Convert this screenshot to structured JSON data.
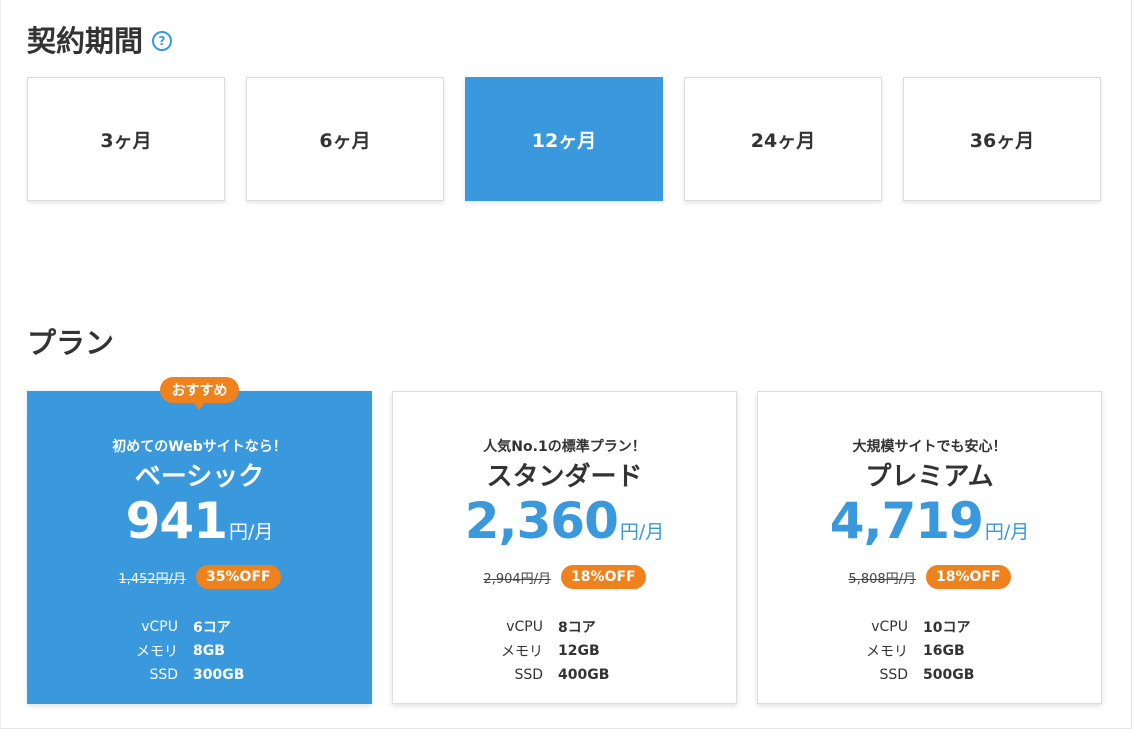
{
  "contract": {
    "title": "契約期間",
    "help_icon": "?",
    "terms": [
      {
        "label": "3ヶ月",
        "selected": false
      },
      {
        "label": "6ヶ月",
        "selected": false
      },
      {
        "label": "12ヶ月",
        "selected": true
      },
      {
        "label": "24ヶ月",
        "selected": false
      },
      {
        "label": "36ヶ月",
        "selected": false
      }
    ]
  },
  "plans": {
    "title": "プラン",
    "recommended_badge": "おすすめ",
    "items": [
      {
        "tagline": "初めてのWebサイトなら！",
        "name": "ベーシック",
        "price": "941",
        "unit": "円/月",
        "old_price": "1,452円/月",
        "discount": "35%OFF",
        "featured": true,
        "specs": [
          {
            "label": "vCPU",
            "value": "6コア"
          },
          {
            "label": "メモリ",
            "value": "8GB"
          },
          {
            "label": "SSD",
            "value": "300GB"
          }
        ]
      },
      {
        "tagline": "人気No.1の標準プラン！",
        "name": "スタンダード",
        "price": "2,360",
        "unit": "円/月",
        "old_price": "2,904円/月",
        "discount": "18%OFF",
        "featured": false,
        "specs": [
          {
            "label": "vCPU",
            "value": "8コア"
          },
          {
            "label": "メモリ",
            "value": "12GB"
          },
          {
            "label": "SSD",
            "value": "400GB"
          }
        ]
      },
      {
        "tagline": "大規模サイトでも安心！",
        "name": "プレミアム",
        "price": "4,719",
        "unit": "円/月",
        "old_price": "5,808円/月",
        "discount": "18%OFF",
        "featured": false,
        "specs": [
          {
            "label": "vCPU",
            "value": "10コア"
          },
          {
            "label": "メモリ",
            "value": "16GB"
          },
          {
            "label": "SSD",
            "value": "500GB"
          }
        ]
      }
    ]
  },
  "colors": {
    "accent": "#3a98dd",
    "badge": "#f0821e",
    "text": "#333333"
  }
}
